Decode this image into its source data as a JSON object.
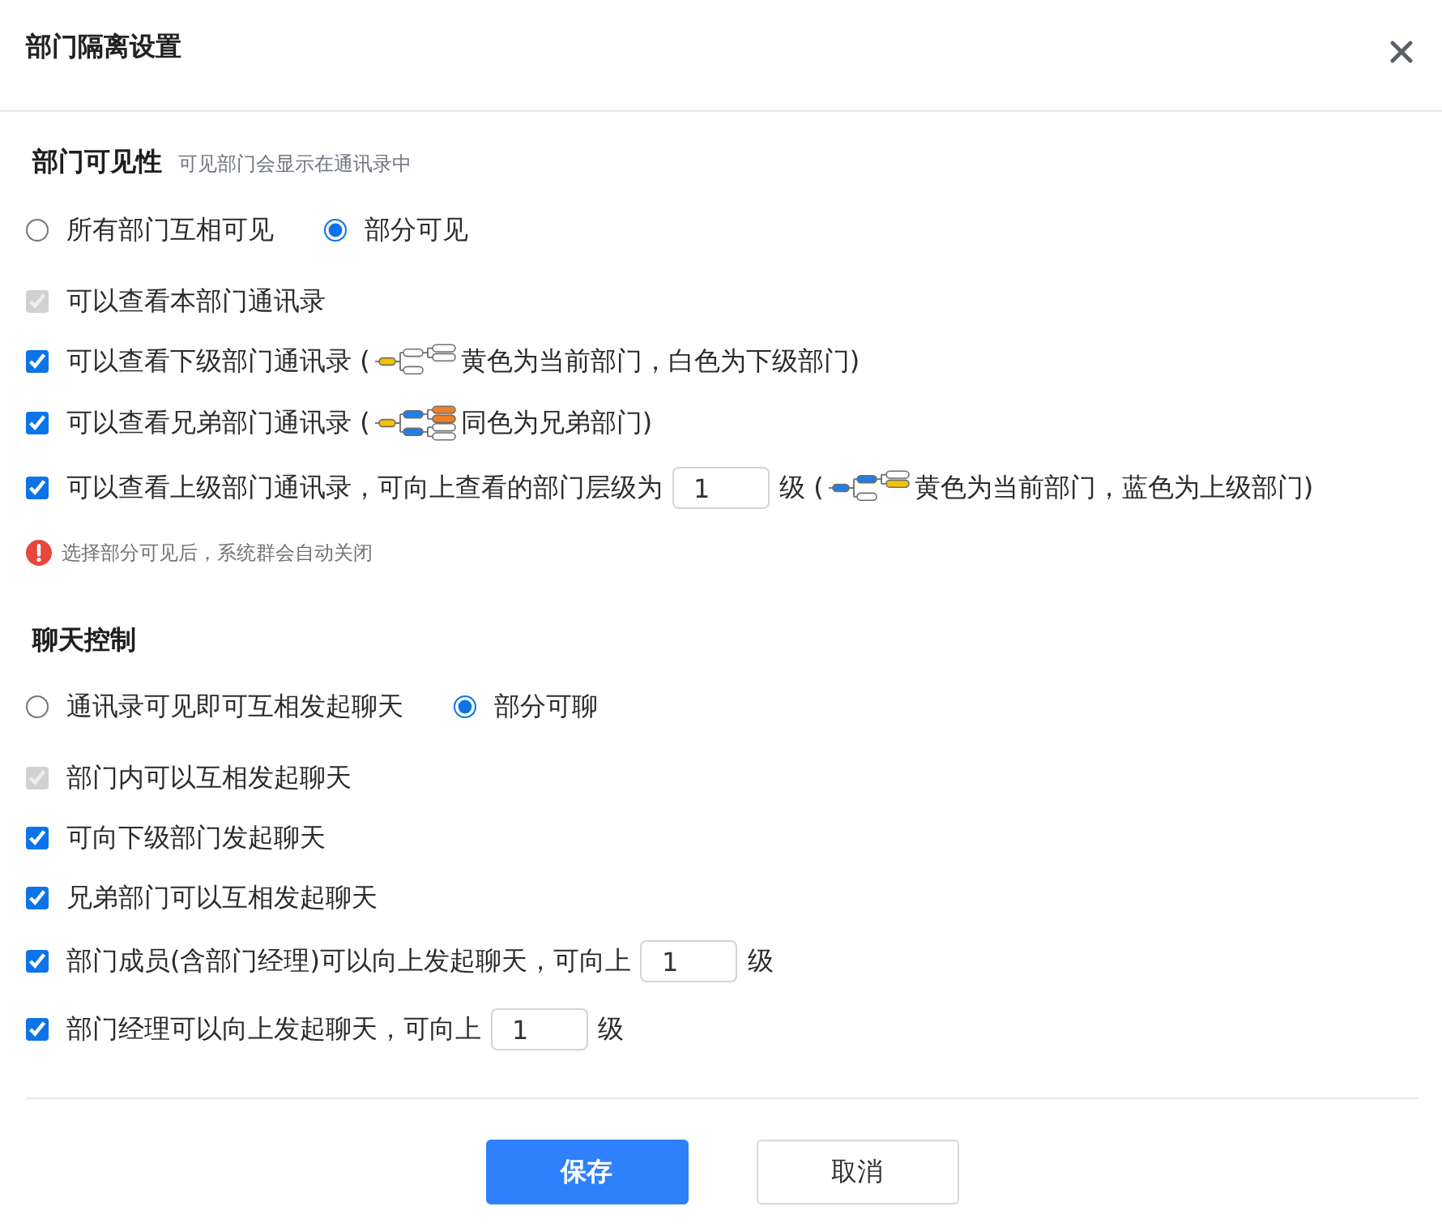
{
  "dialog": {
    "title": "部门隔离设置"
  },
  "sections": [
    {
      "title": "部门可见性",
      "hint": "可见部门会显示在通讯录中",
      "mode_options": [
        {
          "label": "所有部门互相可见",
          "selected": false
        },
        {
          "label": "部分可见",
          "selected": true
        }
      ],
      "options": [
        {
          "label": "可以查看本部门通讯录",
          "checked": true,
          "disabled": true
        },
        {
          "label": "可以查看下级部门通讯录 (",
          "checked": true,
          "disabled": false,
          "legend": {
            "kind": "subordinate",
            "text": "黄色为当前部门，白色为下级部门)"
          }
        },
        {
          "label": "可以查看兄弟部门通讯录 (",
          "checked": true,
          "disabled": false,
          "legend": {
            "kind": "sibling",
            "text": "同色为兄弟部门)"
          }
        },
        {
          "label": "可以查看上级部门通讯录，可向上查看的部门层级为",
          "checked": true,
          "disabled": false,
          "levels": {
            "value": "1",
            "unit": "级 ("
          },
          "legend": {
            "kind": "superior",
            "text": "黄色为当前部门，蓝色为上级部门)"
          }
        }
      ],
      "warning": "选择部分可见后，系统群会自动关闭"
    },
    {
      "title": "聊天控制",
      "mode_options": [
        {
          "label": "通讯录可见即可互相发起聊天",
          "selected": false
        },
        {
          "label": "部分可聊",
          "selected": true
        }
      ],
      "options": [
        {
          "label": "部门内可以互相发起聊天",
          "checked": true,
          "disabled": true
        },
        {
          "label": "可向下级部门发起聊天",
          "checked": true,
          "disabled": false
        },
        {
          "label": "兄弟部门可以互相发起聊天",
          "checked": true,
          "disabled": false
        },
        {
          "label": "部门成员(含部门经理)可以向上发起聊天，可向上",
          "checked": true,
          "disabled": false,
          "levels": {
            "value": "1",
            "unit": "级"
          }
        },
        {
          "label": "部门经理可以向上发起聊天，可向上",
          "checked": true,
          "disabled": false,
          "levels": {
            "value": "1",
            "unit": "级"
          }
        }
      ]
    }
  ],
  "buttons": [
    {
      "label": "保存",
      "kind": "primary"
    },
    {
      "label": "取消",
      "kind": "default"
    }
  ]
}
